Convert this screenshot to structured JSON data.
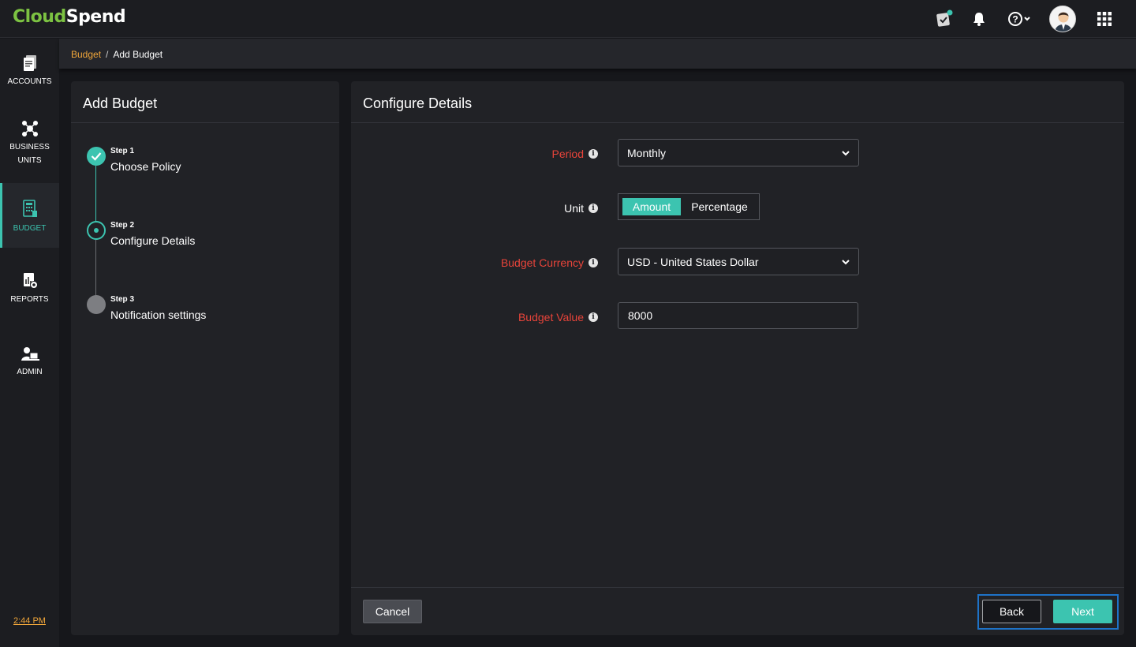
{
  "app": {
    "logo_part1": "Cloud",
    "logo_part2": "Spend"
  },
  "topbar": {
    "icons": [
      "checklist-icon",
      "bell-icon",
      "help-icon",
      "avatar",
      "apps-grid-icon"
    ]
  },
  "nav": {
    "items": [
      {
        "label": "ACCOUNTS",
        "icon": "accounts-icon",
        "active": false
      },
      {
        "label_line1": "BUSINESS",
        "label_line2": "UNITS",
        "icon": "business-units-icon",
        "active": false
      },
      {
        "label": "BUDGET",
        "icon": "budget-icon",
        "active": true
      },
      {
        "label": "REPORTS",
        "icon": "reports-icon",
        "active": false
      },
      {
        "label": "ADMIN",
        "icon": "admin-icon",
        "active": false
      }
    ],
    "clock": "2:44 PM"
  },
  "breadcrumb": {
    "parent": "Budget",
    "separator": "/",
    "current": "Add Budget"
  },
  "wizard": {
    "title": "Add Budget",
    "steps": [
      {
        "number": "Step 1",
        "name": "Choose Policy",
        "state": "complete"
      },
      {
        "number": "Step 2",
        "name": "Configure Details",
        "state": "current"
      },
      {
        "number": "Step 3",
        "name": "Notification settings",
        "state": "pending"
      }
    ]
  },
  "details": {
    "title": "Configure Details",
    "period": {
      "label": "Period",
      "value": "Monthly"
    },
    "unit": {
      "label": "Unit",
      "options": [
        "Amount",
        "Percentage"
      ],
      "selected": "Amount"
    },
    "currency": {
      "label": "Budget Currency",
      "value": "USD - United States Dollar"
    },
    "budget_value": {
      "label": "Budget Value",
      "value": "8000"
    }
  },
  "buttons": {
    "cancel": "Cancel",
    "back": "Back",
    "next": "Next"
  },
  "colors": {
    "accent": "#3cc4b0",
    "required": "#e8443a",
    "link": "#f0a63a",
    "logo_green": "#7cc242",
    "focus": "#1e73c8"
  }
}
